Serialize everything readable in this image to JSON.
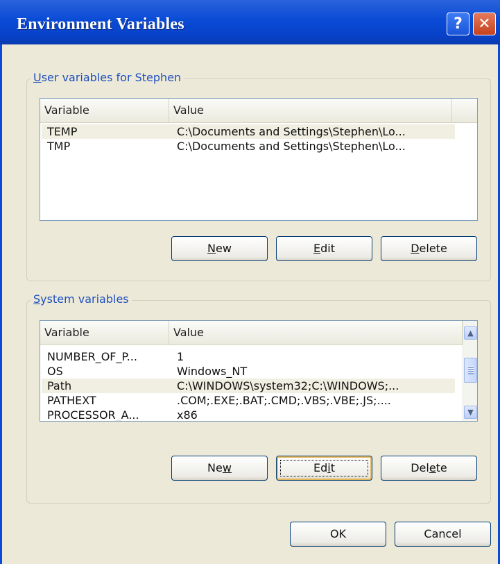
{
  "window": {
    "title": "Environment Variables",
    "help_glyph": "?",
    "close_glyph": "✕"
  },
  "user_group": {
    "legend_underlined": "U",
    "legend_rest": "ser variables for Stephen",
    "columns": [
      "Variable",
      "Value"
    ],
    "rows": [
      {
        "variable": "TEMP",
        "value": "C:\\Documents and Settings\\Stephen\\Lo..."
      },
      {
        "variable": "TMP",
        "value": "C:\\Documents and Settings\\Stephen\\Lo..."
      }
    ],
    "buttons": {
      "new": {
        "underlined": "N",
        "rest": "ew"
      },
      "edit": {
        "underlined": "E",
        "rest": "dit"
      },
      "delete": {
        "underlined": "D",
        "rest": "elete"
      }
    }
  },
  "system_group": {
    "legend_underlined": "S",
    "legend_rest": "ystem variables",
    "columns": [
      "Variable",
      "Value"
    ],
    "rows": [
      {
        "variable": "NUMBER_OF_P...",
        "value": "1"
      },
      {
        "variable": "OS",
        "value": "Windows_NT"
      },
      {
        "variable": "Path",
        "value": "C:\\WINDOWS\\system32;C:\\WINDOWS;..."
      },
      {
        "variable": "PATHEXT",
        "value": ".COM;.EXE;.BAT;.CMD;.VBS;.VBE;.JS;...."
      },
      {
        "variable": "PROCESSOR_A...",
        "value": "x86"
      }
    ],
    "buttons": {
      "new": {
        "pre": "Ne",
        "underlined": "w",
        "rest": ""
      },
      "edit": {
        "pre": "Ed",
        "underlined": "i",
        "rest": "t"
      },
      "delete": {
        "pre": "Del",
        "underlined": "e",
        "rest": "te"
      }
    }
  },
  "footer": {
    "ok_label": "OK",
    "cancel_label": "Cancel"
  }
}
